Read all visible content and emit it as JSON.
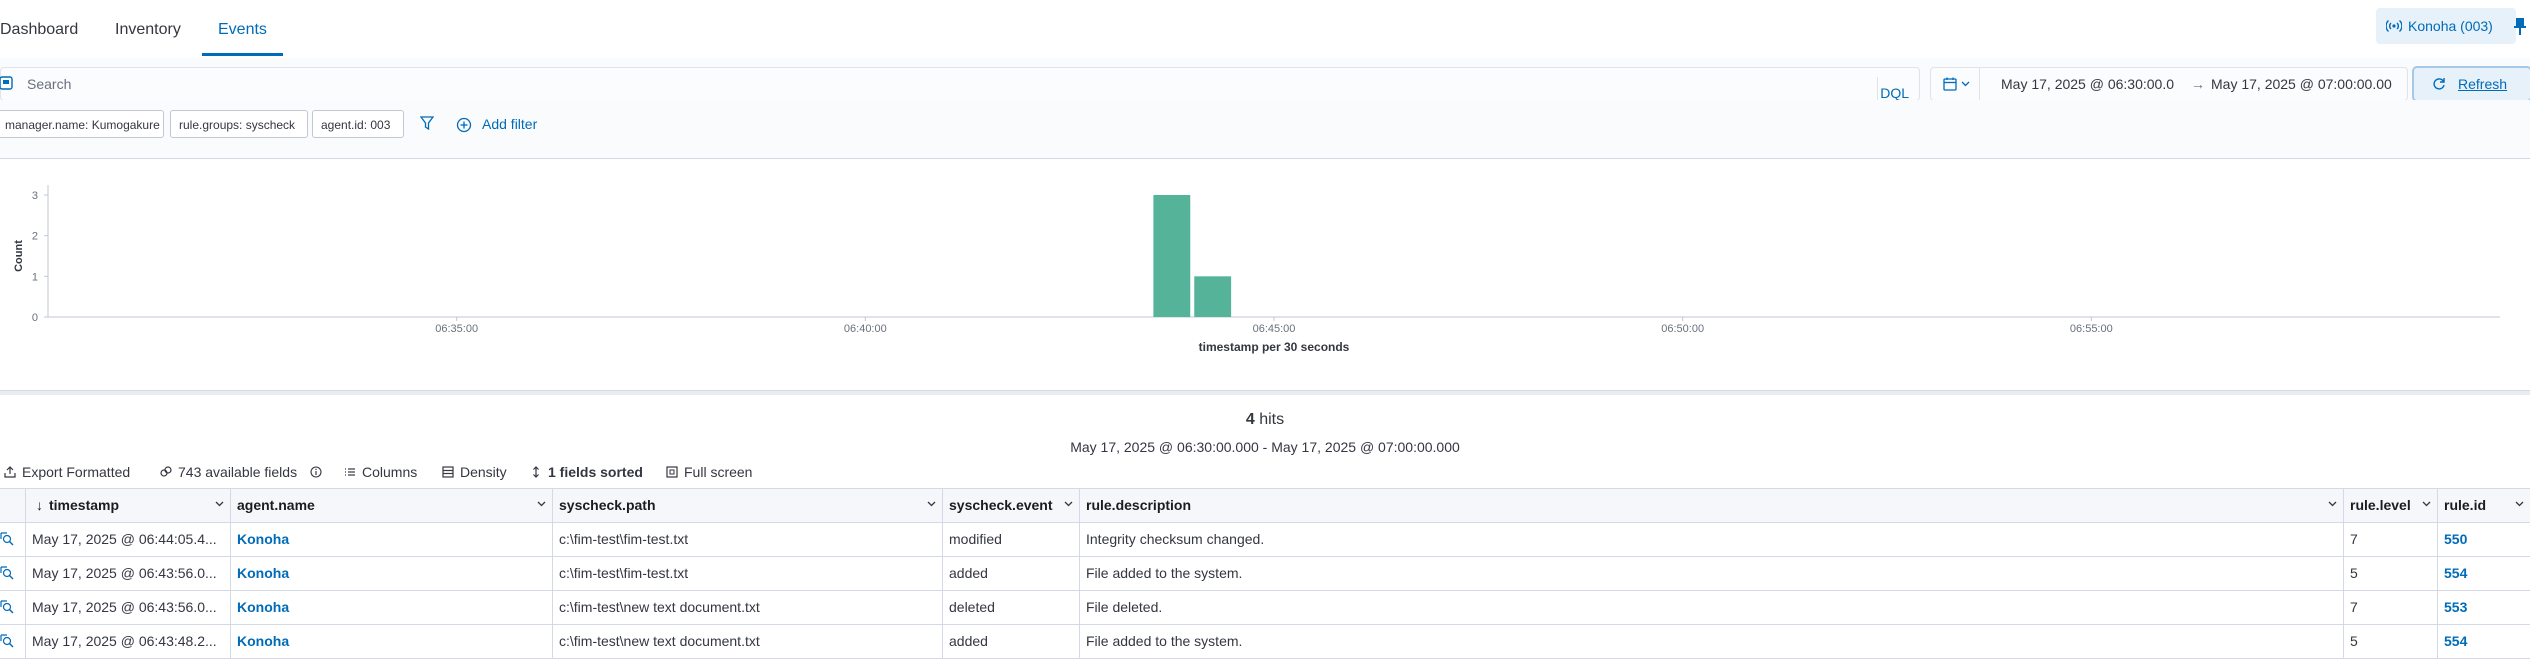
{
  "nav": {
    "tabs": [
      {
        "label": "Dashboard"
      },
      {
        "label": "Inventory"
      },
      {
        "label": "Events"
      }
    ],
    "agent_label": "Konoha (003)"
  },
  "search": {
    "placeholder": "Search",
    "language": "DQL",
    "date_start": "May 17, 2025 @ 06:30:00.0",
    "date_arrow": "→",
    "date_end": "May 17, 2025 @ 07:00:00.00",
    "refresh_label": "Refresh"
  },
  "filters": {
    "pills": [
      {
        "label": "manager.name: Kumogakure"
      },
      {
        "label": "rule.groups: syscheck"
      },
      {
        "label": "agent.id: 003"
      }
    ],
    "add_filter_label": "Add filter"
  },
  "chart_data": {
    "type": "bar",
    "ylabel": "Count",
    "xlabel": "timestamp per 30 seconds",
    "yticks": [
      "0",
      "1",
      "2",
      "3"
    ],
    "ylim": [
      0,
      3
    ],
    "xticks": [
      "06:35:00",
      "06:40:00",
      "06:45:00",
      "06:50:00",
      "06:55:00"
    ],
    "bars": [
      {
        "x": "06:43:30",
        "value": 3
      },
      {
        "x": "06:44:00",
        "value": 1
      }
    ],
    "bar_color": "#54b399",
    "grid": false
  },
  "results": {
    "hits_count": "4",
    "hits_label": "hits",
    "range": "May 17, 2025 @ 06:30:00.000 - May 17, 2025 @ 07:00:00.000"
  },
  "toolbar": {
    "export": "Export Formatted",
    "fields": "743 available fields",
    "columns": "Columns",
    "density": "Density",
    "sorted": "1 fields sorted",
    "fullscreen": "Full screen"
  },
  "table": {
    "columns": [
      {
        "label": "timestamp"
      },
      {
        "label": "agent.name"
      },
      {
        "label": "syscheck.path"
      },
      {
        "label": "syscheck.event"
      },
      {
        "label": "rule.description"
      },
      {
        "label": "rule.level"
      },
      {
        "label": "rule.id"
      }
    ],
    "rows": [
      {
        "timestamp": "May 17, 2025 @ 06:44:05.4...",
        "agent": "Konoha",
        "path": "c:\\fim-test\\fim-test.txt",
        "event": "modified",
        "description": "Integrity checksum changed.",
        "level": "7",
        "id": "550"
      },
      {
        "timestamp": "May 17, 2025 @ 06:43:56.0...",
        "agent": "Konoha",
        "path": "c:\\fim-test\\fim-test.txt",
        "event": "added",
        "description": "File added to the system.",
        "level": "5",
        "id": "554"
      },
      {
        "timestamp": "May 17, 2025 @ 06:43:56.0...",
        "agent": "Konoha",
        "path": "c:\\fim-test\\new text document.txt",
        "event": "deleted",
        "description": "File deleted.",
        "level": "7",
        "id": "553"
      },
      {
        "timestamp": "May 17, 2025 @ 06:43:48.2...",
        "agent": "Konoha",
        "path": "c:\\fim-test\\new text document.txt",
        "event": "added",
        "description": "File added to the system.",
        "level": "5",
        "id": "554"
      }
    ]
  }
}
